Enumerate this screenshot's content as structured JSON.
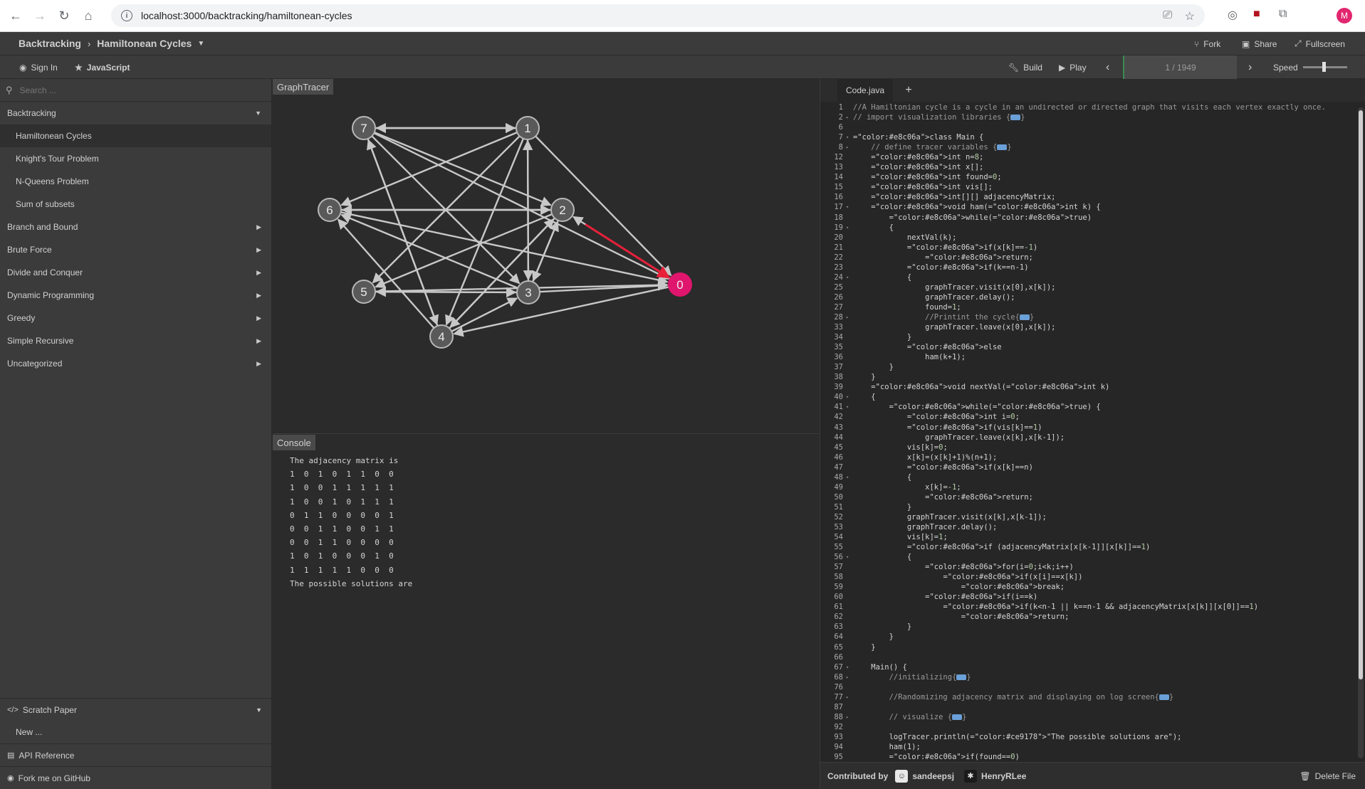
{
  "browser": {
    "url": "localhost:3000/backtracking/hamiltonean-cycles",
    "avatar_letter": "M"
  },
  "header": {
    "breadcrumb_category": "Backtracking",
    "breadcrumb_algorithm": "Hamiltonean Cycles",
    "fork": "Fork",
    "share": "Share",
    "fullscreen": "Fullscreen",
    "sign_in": "Sign In",
    "language": "JavaScript",
    "build": "Build",
    "play": "Play",
    "progress": "1 / 1949",
    "speed": "Speed",
    "speed_level": 0.45
  },
  "sidebar": {
    "search_placeholder": "Search ...",
    "expanded_category": "Backtracking",
    "sub_items": [
      "Hamiltonean Cycles",
      "Knight's Tour Problem",
      "N-Queens Problem",
      "Sum of subsets"
    ],
    "categories": [
      "Branch and Bound",
      "Brute Force",
      "Divide and Conquer",
      "Dynamic Programming",
      "Greedy",
      "Simple Recursive",
      "Uncategorized"
    ],
    "scratch_paper": "Scratch Paper",
    "new_item": "New ...",
    "api_reference": "API Reference",
    "fork_github": "Fork me on GitHub"
  },
  "graph": {
    "tag": "GraphTracer",
    "nodes": [
      "0",
      "1",
      "2",
      "3",
      "4",
      "5",
      "6",
      "7"
    ],
    "highlighted_node": "0",
    "highlighted_edge": [
      "2",
      "0"
    ],
    "colors": {
      "node": "#595959",
      "highlight": "#e0156d",
      "edge": "#c8c8c8",
      "active_edge": "#e8203a"
    }
  },
  "console": {
    "tag": "Console",
    "lines": [
      "The adjacency matrix is",
      "1  0  1  0  1  1  0  0",
      "1  0  0  1  1  1  1  1",
      "1  0  0  1  0  1  1  1",
      "0  1  1  0  0  0  0  1",
      "0  0  1  1  0  0  1  1",
      "0  0  1  1  0  0  0  0",
      "1  0  1  0  0  0  1  0",
      "1  1  1  1  1  0  0  0",
      "The possible solutions are"
    ]
  },
  "code": {
    "tab": "Code.java",
    "add": "+",
    "lines": [
      {
        "n": "1",
        "f": "",
        "t": "//A Hamiltonian cycle is a cycle in an undirected or directed graph that visits each vertex exactly once."
      },
      {
        "n": "2",
        "f": "▸",
        "t": "// import visualization libraries {▭}"
      },
      {
        "n": "6",
        "f": "",
        "t": ""
      },
      {
        "n": "7",
        "f": "▾",
        "t": "class Main {"
      },
      {
        "n": "8",
        "f": "▸",
        "t": "    // define tracer variables {▭}"
      },
      {
        "n": "12",
        "f": "",
        "t": "    int n=8;"
      },
      {
        "n": "13",
        "f": "",
        "t": "    int x[];"
      },
      {
        "n": "14",
        "f": "",
        "t": "    int found=0;"
      },
      {
        "n": "15",
        "f": "",
        "t": "    int vis[];"
      },
      {
        "n": "16",
        "f": "",
        "t": "    int[][] adjacencyMatrix;"
      },
      {
        "n": "17",
        "f": "▾",
        "t": "    void ham(int k) {"
      },
      {
        "n": "18",
        "f": "",
        "t": "        while(true)"
      },
      {
        "n": "19",
        "f": "▾",
        "t": "        {"
      },
      {
        "n": "20",
        "f": "",
        "t": "            nextVal(k);"
      },
      {
        "n": "21",
        "f": "",
        "t": "            if(x[k]==-1)"
      },
      {
        "n": "22",
        "f": "",
        "t": "                return;"
      },
      {
        "n": "23",
        "f": "",
        "t": "            if(k==n-1)"
      },
      {
        "n": "24",
        "f": "▾",
        "t": "            {"
      },
      {
        "n": "25",
        "f": "",
        "t": "                graphTracer.visit(x[0],x[k]);"
      },
      {
        "n": "26",
        "f": "",
        "t": "                graphTracer.delay();"
      },
      {
        "n": "27",
        "f": "",
        "t": "                found=1;"
      },
      {
        "n": "28",
        "f": "▸",
        "t": "                //Printint the cycle{▭}"
      },
      {
        "n": "33",
        "f": "",
        "t": "                graphTracer.leave(x[0],x[k]);"
      },
      {
        "n": "34",
        "f": "",
        "t": "            }"
      },
      {
        "n": "35",
        "f": "",
        "t": "            else"
      },
      {
        "n": "36",
        "f": "",
        "t": "                ham(k+1);"
      },
      {
        "n": "37",
        "f": "",
        "t": "        }"
      },
      {
        "n": "38",
        "f": "",
        "t": "    }"
      },
      {
        "n": "39",
        "f": "",
        "t": "    void nextVal(int k)"
      },
      {
        "n": "40",
        "f": "▾",
        "t": "    {"
      },
      {
        "n": "41",
        "f": "▾",
        "t": "        while(true) {"
      },
      {
        "n": "42",
        "f": "",
        "t": "            int i=0;"
      },
      {
        "n": "43",
        "f": "",
        "t": "            if(vis[k]==1)"
      },
      {
        "n": "44",
        "f": "",
        "t": "                graphTracer.leave(x[k],x[k-1]);"
      },
      {
        "n": "45",
        "f": "",
        "t": "            vis[k]=0;"
      },
      {
        "n": "46",
        "f": "",
        "t": "            x[k]=(x[k]+1)%(n+1);"
      },
      {
        "n": "47",
        "f": "",
        "t": "            if(x[k]==n)"
      },
      {
        "n": "48",
        "f": "▾",
        "t": "            {"
      },
      {
        "n": "49",
        "f": "",
        "t": "                x[k]=-1;"
      },
      {
        "n": "50",
        "f": "",
        "t": "                return;"
      },
      {
        "n": "51",
        "f": "",
        "t": "            }"
      },
      {
        "n": "52",
        "f": "",
        "t": "            graphTracer.visit(x[k],x[k-1]);"
      },
      {
        "n": "53",
        "f": "",
        "t": "            graphTracer.delay();"
      },
      {
        "n": "54",
        "f": "",
        "t": "            vis[k]=1;"
      },
      {
        "n": "55",
        "f": "",
        "t": "            if (adjacencyMatrix[x[k-1]][x[k]]==1)"
      },
      {
        "n": "56",
        "f": "▾",
        "t": "            {"
      },
      {
        "n": "57",
        "f": "",
        "t": "                for(i=0;i<k;i++)"
      },
      {
        "n": "58",
        "f": "",
        "t": "                    if(x[i]==x[k])"
      },
      {
        "n": "59",
        "f": "",
        "t": "                        break;"
      },
      {
        "n": "60",
        "f": "",
        "t": "                if(i==k)"
      },
      {
        "n": "61",
        "f": "",
        "t": "                    if(k<n-1 || k==n-1 && adjacencyMatrix[x[k]][x[0]]==1)"
      },
      {
        "n": "62",
        "f": "",
        "t": "                        return;"
      },
      {
        "n": "63",
        "f": "",
        "t": "            }"
      },
      {
        "n": "64",
        "f": "",
        "t": "        }"
      },
      {
        "n": "65",
        "f": "",
        "t": "    }"
      },
      {
        "n": "66",
        "f": "",
        "t": ""
      },
      {
        "n": "67",
        "f": "▾",
        "t": "    Main() {"
      },
      {
        "n": "68",
        "f": "▸",
        "t": "        //initializing{▭}"
      },
      {
        "n": "76",
        "f": "",
        "t": ""
      },
      {
        "n": "77",
        "f": "▸",
        "t": "        //Randomizing adjacency matrix and displaying on log screen{▭}"
      },
      {
        "n": "87",
        "f": "",
        "t": ""
      },
      {
        "n": "88",
        "f": "▸",
        "t": "        // visualize {▭}"
      },
      {
        "n": "92",
        "f": "",
        "t": ""
      },
      {
        "n": "93",
        "f": "",
        "t": "        logTracer.println(\"The possible solutions are\");"
      },
      {
        "n": "94",
        "f": "",
        "t": "        ham(1);"
      },
      {
        "n": "95",
        "f": "",
        "t": "        if(found==0)"
      }
    ]
  },
  "footer": {
    "contributed_by": "Contributed by",
    "contributors": [
      "sandeepsj",
      "HenryRLee"
    ],
    "delete_file": "Delete File"
  }
}
